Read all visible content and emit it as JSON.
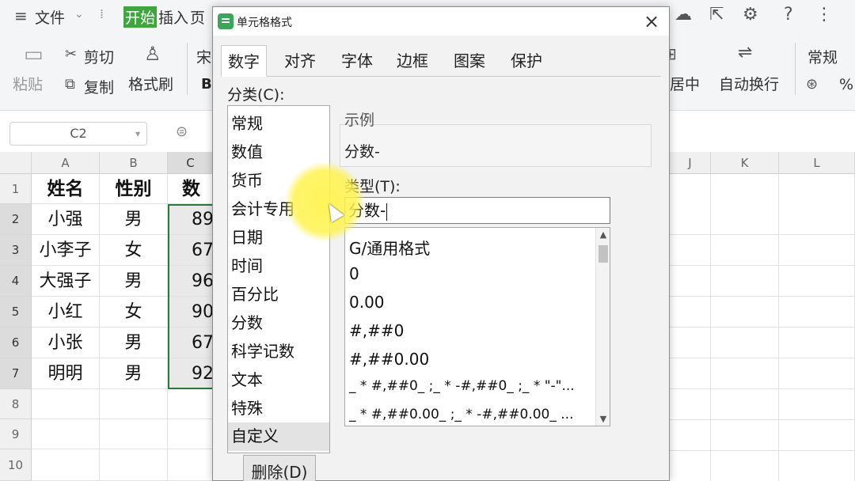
{
  "menubar": {
    "file_label": "文件",
    "start_tab": "开始",
    "insert_tab": "插入",
    "page_tab_partial": "页"
  },
  "toolbar": {
    "paste_label": "粘贴",
    "cut_label": "剪切",
    "copy_label": "复制",
    "format_painter_label": "格式刷",
    "font_partial": "宋",
    "merge_center_partial": "居中",
    "wrap_text_label": "自动换行",
    "number_format": "常规",
    "percent_symbol": "%"
  },
  "formula_bar": {
    "name_box": "C2"
  },
  "sheet": {
    "columns": [
      "A",
      "B",
      "C",
      "J",
      "K",
      "L"
    ],
    "rows": [
      "1",
      "2",
      "3",
      "4",
      "5",
      "6",
      "7",
      "8",
      "9",
      "10"
    ],
    "header_row": [
      "姓名",
      "性别",
      "数学"
    ],
    "data": [
      [
        "小强",
        "男",
        "89"
      ],
      [
        "小李子",
        "女",
        "67"
      ],
      [
        "大强子",
        "男",
        "96"
      ],
      [
        "小红",
        "女",
        "90"
      ],
      [
        "小张",
        "男",
        "67"
      ],
      [
        "明明",
        "男",
        "92"
      ]
    ]
  },
  "dialog": {
    "title": "单元格格式",
    "close_symbol": "×",
    "tabs": [
      "数字",
      "对齐",
      "字体",
      "边框",
      "图案",
      "保护"
    ],
    "active_tab": "数字",
    "category_label": "分类(C):",
    "categories": [
      "常规",
      "数值",
      "货币",
      "会计专用",
      "日期",
      "时间",
      "百分比",
      "分数",
      "科学记数",
      "文本",
      "特殊",
      "自定义"
    ],
    "selected_category": "自定义",
    "sample_label": "示例",
    "sample_value": "分数-",
    "type_label": "类型(T):",
    "type_value": "分数-",
    "format_codes": [
      "G/通用格式",
      "0",
      "0.00",
      "#,##0",
      "#,##0.00",
      "_ * #,##0_ ;_ * -#,##0_ ;_ * \"-\"...",
      "_ * #,##0.00_ ;_ * -#,##0.00_ ..."
    ],
    "delete_button": "删除(D)"
  }
}
